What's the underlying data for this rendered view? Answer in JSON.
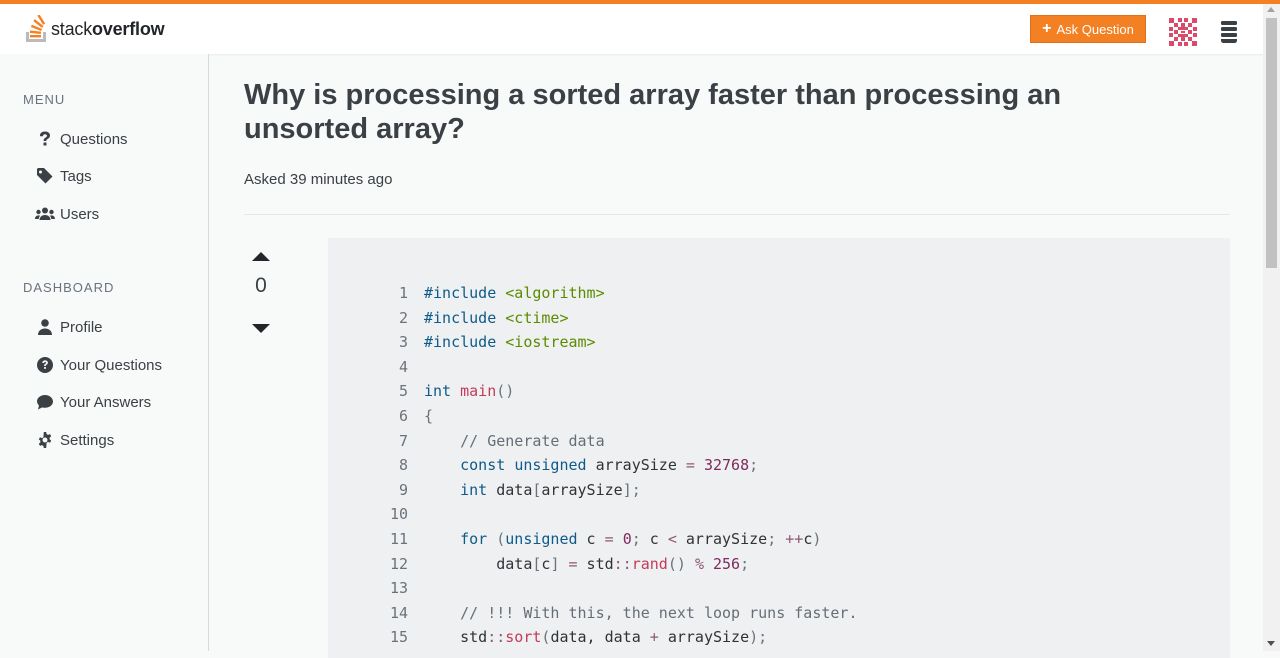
{
  "header": {
    "logo_text_light": "stack",
    "logo_text_bold": "overflow",
    "ask_button_label": "Ask Question",
    "accent_color": "#f48024"
  },
  "sidebar": {
    "menu_label": "MENU",
    "menu_items": [
      {
        "label": "Questions",
        "icon": "question-icon"
      },
      {
        "label": "Tags",
        "icon": "tag-icon"
      },
      {
        "label": "Users",
        "icon": "users-icon"
      }
    ],
    "dashboard_label": "DASHBOARD",
    "dashboard_items": [
      {
        "label": "Profile",
        "icon": "user-icon"
      },
      {
        "label": "Your Questions",
        "icon": "question-circle-icon"
      },
      {
        "label": "Your Answers",
        "icon": "comment-icon"
      },
      {
        "label": "Settings",
        "icon": "gear-icon"
      }
    ]
  },
  "question": {
    "title": "Why is processing a sorted array faster than processing an unsorted array?",
    "asked": "Asked 39 minutes ago",
    "votes": "0"
  },
  "code": {
    "lines": [
      {
        "n": "1",
        "text": "#include <algorithm>"
      },
      {
        "n": "2",
        "text": "#include <ctime>"
      },
      {
        "n": "3",
        "text": "#include <iostream>"
      },
      {
        "n": "4",
        "text": ""
      },
      {
        "n": "5",
        "text": "int main()"
      },
      {
        "n": "6",
        "text": "{"
      },
      {
        "n": "7",
        "text": "    // Generate data"
      },
      {
        "n": "8",
        "text": "    const unsigned arraySize = 32768;"
      },
      {
        "n": "9",
        "text": "    int data[arraySize];"
      },
      {
        "n": "10",
        "text": ""
      },
      {
        "n": "11",
        "text": "    for (unsigned c = 0; c < arraySize; ++c)"
      },
      {
        "n": "12",
        "text": "        data[c] = std::rand() % 256;"
      },
      {
        "n": "13",
        "text": ""
      },
      {
        "n": "14",
        "text": "    // !!! With this, the next loop runs faster."
      },
      {
        "n": "15",
        "text": "    std::sort(data, data + arraySize);"
      }
    ]
  }
}
